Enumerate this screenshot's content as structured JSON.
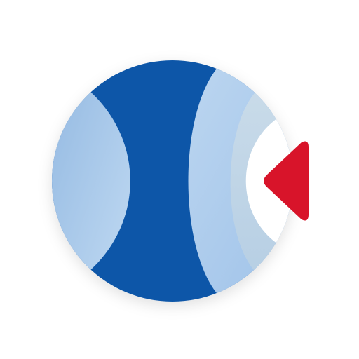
{
  "logo": {
    "icon": "circular-brand-logo-icon",
    "colors": {
      "background": "#ffffff",
      "primary_blue": "#0f57a8",
      "light_blue_left": "#9cc1e6",
      "light_blue_arc": "#a9cbee",
      "pale_blue_arc": "#c2d8ea",
      "accent_red": "#d8142a"
    }
  }
}
